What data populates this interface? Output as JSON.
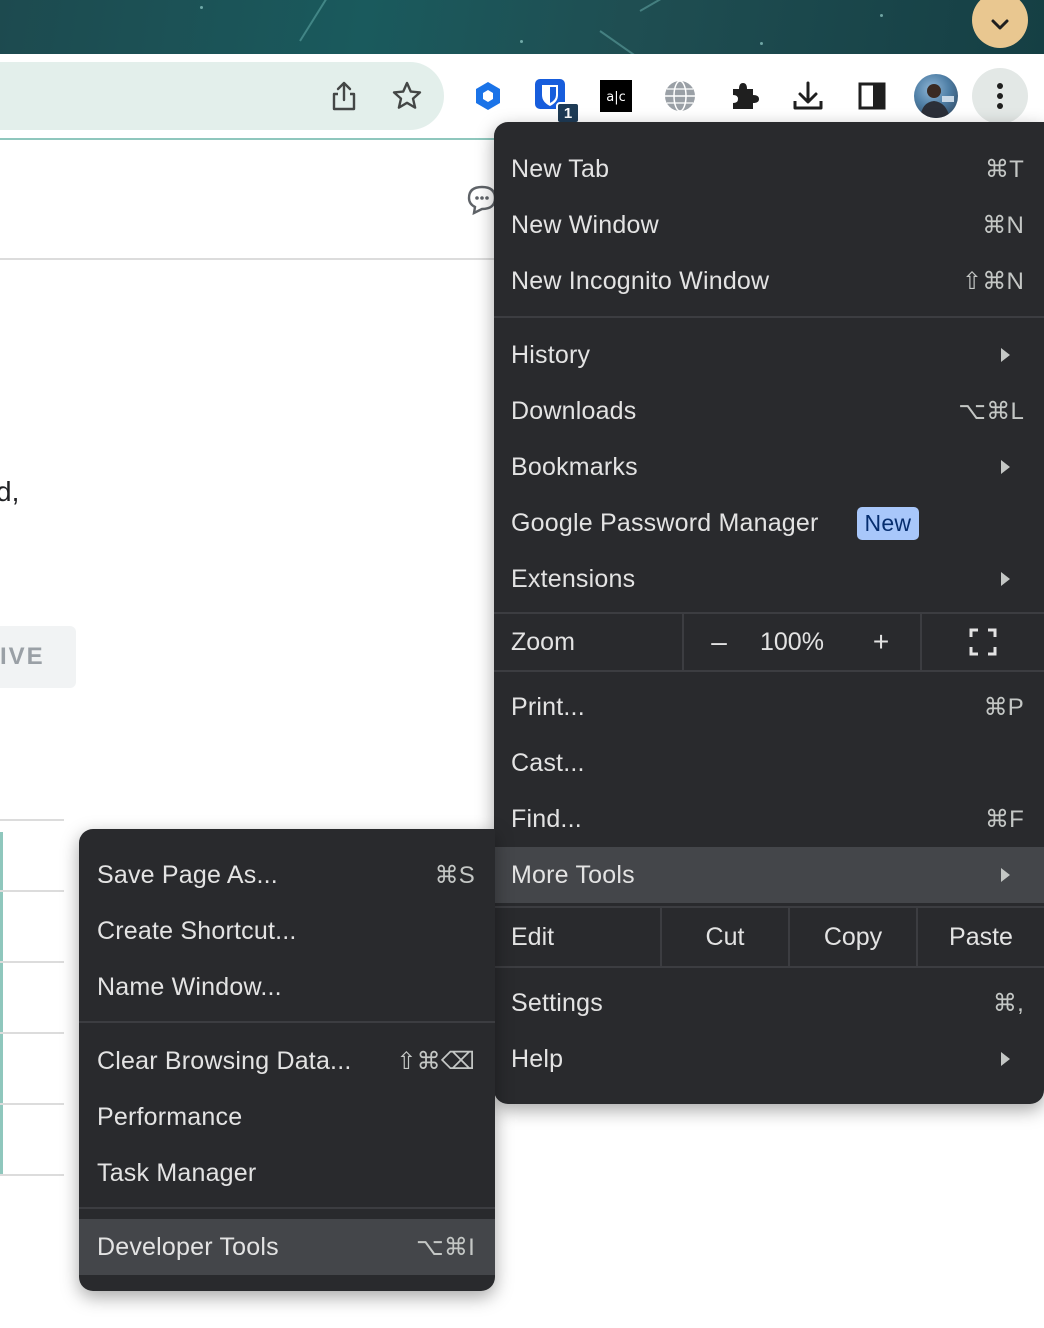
{
  "page": {
    "fragment_text": "d,",
    "tag_text": "IVE"
  },
  "toolbar": {
    "extension_badge_count": "1",
    "icons": [
      "share-icon",
      "bookmark-star-icon",
      "extension-hex-icon",
      "password-manager-icon",
      "alc-extension-icon",
      "globe-icon",
      "puzzle-extensions-icon",
      "download-icon",
      "side-panel-icon",
      "kebab-menu-icon"
    ]
  },
  "menu": {
    "group1": [
      {
        "label": "New Tab",
        "shortcut": "⌘T"
      },
      {
        "label": "New Window",
        "shortcut": "⌘N"
      },
      {
        "label": "New Incognito Window",
        "shortcut": "⇧⌘N"
      }
    ],
    "history": {
      "label": "History"
    },
    "downloads": {
      "label": "Downloads",
      "shortcut": "⌥⌘L"
    },
    "bookmarks": {
      "label": "Bookmarks"
    },
    "password_manager": {
      "label": "Google Password Manager",
      "badge": "New"
    },
    "extensions": {
      "label": "Extensions"
    },
    "zoom": {
      "label": "Zoom",
      "minus": "–",
      "value": "100%",
      "plus": "+"
    },
    "print": {
      "label": "Print...",
      "shortcut": "⌘P"
    },
    "cast": {
      "label": "Cast..."
    },
    "find": {
      "label": "Find...",
      "shortcut": "⌘F"
    },
    "more_tools": {
      "label": "More Tools"
    },
    "edit": {
      "label": "Edit",
      "cut": "Cut",
      "copy": "Copy",
      "paste": "Paste"
    },
    "settings": {
      "label": "Settings",
      "shortcut": "⌘,"
    },
    "help": {
      "label": "Help"
    }
  },
  "submenu": {
    "save_page": {
      "label": "Save Page As...",
      "shortcut": "⌘S"
    },
    "create_shortcut": {
      "label": "Create Shortcut..."
    },
    "name_window": {
      "label": "Name Window..."
    },
    "clear_browsing": {
      "label": "Clear Browsing Data...",
      "shortcut": "⇧⌘⌫"
    },
    "performance": {
      "label": "Performance"
    },
    "task_manager": {
      "label": "Task Manager"
    },
    "developer_tools": {
      "label": "Developer Tools",
      "shortcut": "⌥⌘I"
    }
  },
  "colors": {
    "menu_bg": "#292a2d",
    "menu_highlight": "#44464a",
    "badge_bg": "#a8c7fa",
    "tab_search_bg": "#e9c790"
  }
}
